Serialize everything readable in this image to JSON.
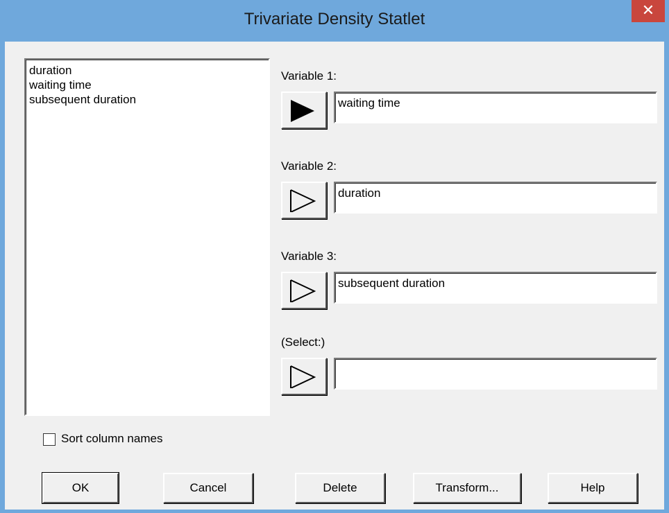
{
  "window": {
    "title": "Trivariate Density Statlet",
    "close_glyph": "✕"
  },
  "column_list": {
    "items": [
      "duration",
      "waiting time",
      "subsequent duration"
    ]
  },
  "variables": [
    {
      "label": "Variable 1:",
      "value": "waiting time",
      "button_state": "filled"
    },
    {
      "label": "Variable 2:",
      "value": "duration",
      "button_state": "outline"
    },
    {
      "label": "Variable 3:",
      "value": "subsequent duration",
      "button_state": "outline"
    },
    {
      "label": "(Select:)",
      "value": "",
      "button_state": "outline"
    }
  ],
  "sort_checkbox": {
    "label": "Sort column names",
    "checked": false
  },
  "buttons": {
    "ok": "OK",
    "cancel": "Cancel",
    "delete": "Delete",
    "transform": "Transform...",
    "help": "Help"
  },
  "colors": {
    "titlebar": "#6fa8dc",
    "close": "#c9463d",
    "dialog": "#f0f0f0"
  }
}
